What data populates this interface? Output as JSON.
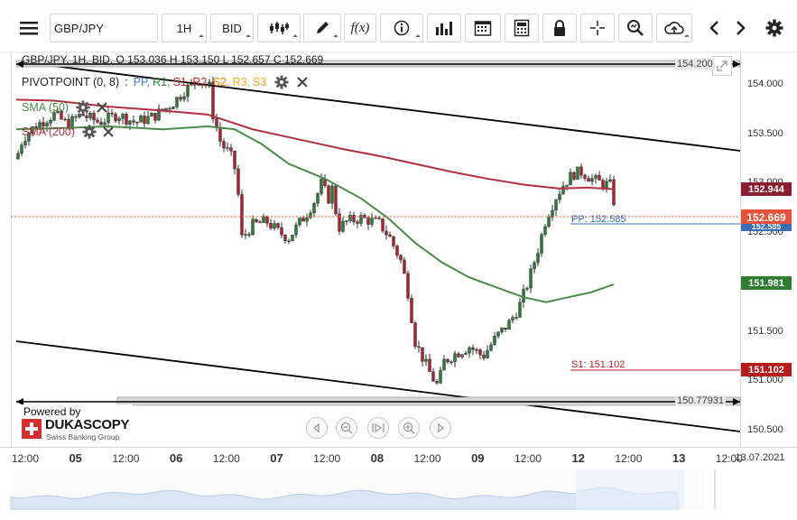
{
  "toolbar": {
    "menu_icon": "hamburger-icon",
    "symbol_value": "GBP/JPY",
    "timeframe": "1H",
    "price_side": "BID",
    "icons": [
      "candlestick-type-icon",
      "draw-pencil-icon",
      "function-icon",
      "info-icon",
      "bar-chart-icon",
      "calendar-icon",
      "calculator-icon",
      "lock-icon",
      "crosshair-icon",
      "zoom-icon",
      "cloud-upload-icon",
      "prev-arrow-icon",
      "next-arrow-icon",
      "settings-gear-icon"
    ],
    "fx_label": "f(x)"
  },
  "legend": {
    "ohlc_line": "GBP/JPY, 1H, BID, O 153.036 H 153.150 L 152.657 C 152.669",
    "pivot_name": "PIVOTPOINT (0, 8)",
    "pivot_sep": ":",
    "pivot_levels": [
      {
        "label": "PP,",
        "color": "#3a78c8"
      },
      {
        "label": "R1,",
        "color": "#2e7d32"
      },
      {
        "label": "S1,",
        "color": "#c62828"
      },
      {
        "label": "R2,",
        "color": "#c62828"
      },
      {
        "label": "S2,",
        "color": "#f57c00"
      },
      {
        "label": "R3,",
        "color": "#f9a825"
      },
      {
        "label": "S3",
        "color": "#f9a825"
      }
    ],
    "sma50": "SMA (50)",
    "sma200": "SMA (200)",
    "sma50_color": "#4a8a4a",
    "sma200_color": "#b03040"
  },
  "price_axis": {
    "labels": [
      "154.000",
      "153.500",
      "153.000",
      "152.500",
      "152.000",
      "151.500",
      "151.000",
      "150.500"
    ],
    "badges": {
      "sma200": {
        "text": "152.944",
        "color": "#8b1e2e"
      },
      "last": {
        "text": "152.669",
        "color": "#e8523c"
      },
      "pp": {
        "text": "152.585",
        "color": "#3a6fb8"
      },
      "sma50": {
        "text": "151.981",
        "color": "#2e7d32"
      },
      "s1": {
        "text": "151.102",
        "color": "#b71c1c"
      }
    }
  },
  "lines": {
    "top_channel_label": "154.200",
    "bottom_channel_label": "150.77931",
    "pp_label": "PP: 152.585",
    "s1_label": "S1: 151.102"
  },
  "time_axis": {
    "labels": [
      {
        "text": "12:00",
        "day": false
      },
      {
        "text": "05",
        "day": true
      },
      {
        "text": "12:00",
        "day": false
      },
      {
        "text": "06",
        "day": true
      },
      {
        "text": "12:00",
        "day": false
      },
      {
        "text": "07",
        "day": true
      },
      {
        "text": "12:00",
        "day": false
      },
      {
        "text": "08",
        "day": true
      },
      {
        "text": "12:00",
        "day": false
      },
      {
        "text": "09",
        "day": true
      },
      {
        "text": "12:00",
        "day": false
      },
      {
        "text": "12",
        "day": true
      },
      {
        "text": "12:00",
        "day": false
      },
      {
        "text": "13",
        "day": true
      },
      {
        "text": "12:00",
        "day": false
      }
    ],
    "end_date": "13.07.2021"
  },
  "branding": {
    "powered_by": "Powered by",
    "company": "DUKASCOPY",
    "tagline": "Swiss Banking Group"
  },
  "nav_controls": [
    "scroll-left-icon",
    "zoom-out-icon",
    "reset-icon",
    "zoom-in-icon",
    "scroll-right-icon"
  ]
}
